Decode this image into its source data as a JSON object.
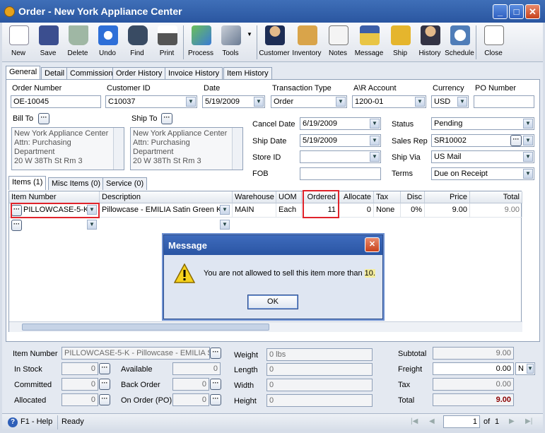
{
  "window": {
    "title": "Order - New York Appliance Center",
    "min": "_",
    "max": "□",
    "close": "✕"
  },
  "toolbar": [
    {
      "label": "New",
      "icon": "new-document-icon"
    },
    {
      "label": "Save",
      "icon": "floppy-disk-icon"
    },
    {
      "label": "Delete",
      "icon": "recycle-bin-icon"
    },
    {
      "label": "Undo",
      "icon": "undo-arrow-icon"
    },
    {
      "label": "Find",
      "icon": "binoculars-icon"
    },
    {
      "label": "Print",
      "icon": "printer-icon"
    },
    {
      "label": "Process",
      "icon": "process-icon"
    },
    {
      "label": "Tools",
      "icon": "tools-icon"
    },
    {
      "label": "Customer",
      "icon": "customer-icon"
    },
    {
      "label": "Inventory",
      "icon": "boxes-icon"
    },
    {
      "label": "Notes",
      "icon": "notes-icon"
    },
    {
      "label": "Message",
      "icon": "message-icon"
    },
    {
      "label": "Ship",
      "icon": "forklift-icon"
    },
    {
      "label": "History",
      "icon": "history-icon"
    },
    {
      "label": "Schedule",
      "icon": "schedule-icon"
    },
    {
      "label": "Close",
      "icon": "close-doc-icon"
    }
  ],
  "tabs": [
    "General",
    "Detail",
    "Commission",
    "Order History",
    "Invoice History",
    "Item History"
  ],
  "header": {
    "order_number_label": "Order Number",
    "order_number": "OE-10045",
    "customer_id_label": "Customer ID",
    "customer_id": "C10037",
    "date_label": "Date",
    "date": "5/19/2009",
    "transaction_type_label": "Transaction Type",
    "transaction_type": "Order",
    "ar_account_label": "A\\R Account",
    "ar_account": "1200-01",
    "currency_label": "Currency",
    "currency": "USD",
    "po_number_label": "PO Number",
    "po_number": ""
  },
  "bill_to": {
    "label": "Bill To",
    "lines": [
      "New York Appliance Center",
      "Attn: Purchasing",
      "Department",
      "20 W 38Th St Rm 3"
    ]
  },
  "ship_to": {
    "label": "Ship To",
    "lines": [
      "New York Appliance Center",
      "Attn: Purchasing",
      "Department",
      "20 W 38Th St Rm 3"
    ]
  },
  "dates": {
    "cancel_label": "Cancel Date",
    "cancel": "6/19/2009",
    "ship_label": "Ship Date",
    "ship": "5/19/2009",
    "store_label": "Store ID",
    "store": "",
    "fob_label": "FOB",
    "fob": ""
  },
  "right": {
    "status_label": "Status",
    "status": "Pending",
    "sales_rep_label": "Sales Rep",
    "sales_rep": "SR10002",
    "ship_via_label": "Ship Via",
    "ship_via": "US Mail",
    "terms_label": "Terms",
    "terms": "Due on Receipt"
  },
  "item_tabs": [
    "Items (1)",
    "Misc Items (0)",
    "Service (0)"
  ],
  "grid": {
    "columns": [
      "Item Number",
      "Description",
      "Warehouse",
      "UOM",
      "Ordered",
      "Allocate",
      "Tax",
      "Disc",
      "Price",
      "Total"
    ],
    "row": {
      "item": "PILLOWCASE-5-K",
      "description": "Pillowcase - EMILIA Satin Green Kin",
      "warehouse": "MAIN",
      "uom": "Each",
      "ordered": "11",
      "allocate": "0",
      "tax": "None",
      "disc": "0%",
      "price": "9.00",
      "total": "9.00"
    }
  },
  "dialog": {
    "title": "Message",
    "text_pre": "You are not allowed to sell this item more than ",
    "text_limit": "10.",
    "ok": "OK"
  },
  "footer": {
    "item_number_label": "Item Number",
    "item_number": "PILLOWCASE-5-K - Pillowcase - EMILIA Sat",
    "in_stock_label": "In Stock",
    "in_stock": "0",
    "committed_label": "Committed",
    "committed": "0",
    "allocated_label": "Allocated",
    "allocated": "0",
    "available_label": "Available",
    "available": "0",
    "back_order_label": "Back Order",
    "back_order": "0",
    "on_order_label": "On Order (PO)",
    "on_order": "0",
    "weight_label": "Weight",
    "weight": "0 lbs",
    "length_label": "Length",
    "length": "0",
    "width_label": "Width",
    "width": "0",
    "height_label": "Height",
    "height": "0",
    "subtotal_label": "Subtotal",
    "subtotal": "9.00",
    "freight_label": "Freight",
    "freight": "0.00",
    "freight_code": "N",
    "tax_label": "Tax",
    "tax": "0.00",
    "total_label": "Total",
    "total": "9.00"
  },
  "status": {
    "help": "F1 - Help",
    "text": "Ready",
    "page": "1",
    "of_label": "of",
    "pages": "1"
  },
  "colors": {
    "title_bar": "#2a56a0",
    "highlight": "#e0232b",
    "total_red": "#8b0000"
  }
}
